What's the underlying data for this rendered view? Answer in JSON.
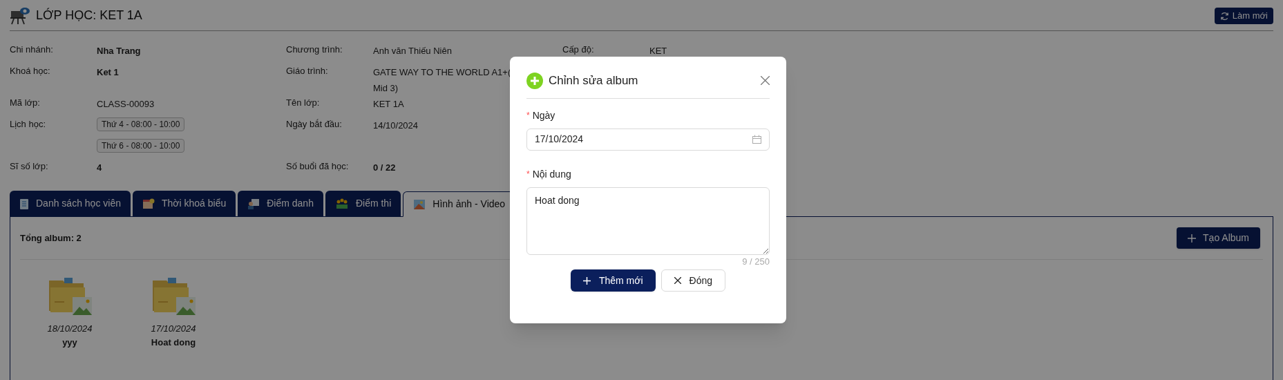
{
  "page": {
    "title": "LỚP HỌC: KET 1A",
    "refresh_button": "Làm mới"
  },
  "info_columns": [
    {
      "rows": [
        {
          "label": "Chi nhánh:",
          "values": [
            "Nha Trang"
          ],
          "bold": true
        },
        {
          "label": "Khoá học:",
          "values": [
            "Ket 1"
          ],
          "bold": true
        },
        {
          "label": "Mã lớp:",
          "values": [
            "CLASS-00093"
          ],
          "bold": false
        },
        {
          "label": "Lịch học:",
          "chips": [
            "Thứ 4 - 08:00 - 10:00",
            "Thứ 6 - 08:00 - 10:00"
          ]
        },
        {
          "label": "Sĩ số lớp:",
          "values": [
            "4"
          ],
          "bold": true
        }
      ]
    },
    {
      "rows": [
        {
          "label": "Chương trình:",
          "values": [
            "Anh văn Thiếu Niên"
          ],
          "bold": false
        },
        {
          "label": "Giáo trình:",
          "values": [
            "GATE WAY TO THE WORLD A1+(",
            "Mid 3)"
          ],
          "bold": false
        },
        {
          "label": "Tên lớp:",
          "values": [
            "KET 1A"
          ],
          "bold": false
        },
        {
          "label": "Ngày bắt đầu:",
          "values": [
            "14/10/2024"
          ],
          "bold": false
        },
        {
          "label": "Số buổi đã học:",
          "values": [
            "0 / 22"
          ],
          "bold": true
        }
      ]
    },
    {
      "rows": [
        {
          "label": "Cấp độ:",
          "values": [
            "KET"
          ],
          "bold": false
        }
      ]
    }
  ],
  "tabs": [
    {
      "label": "Danh sách học viên",
      "kind": "list",
      "selected": false
    },
    {
      "label": "Thời khoá biểu",
      "kind": "calendar",
      "selected": false
    },
    {
      "label": "Điểm danh",
      "kind": "attendance",
      "selected": false
    },
    {
      "label": "Điểm thi",
      "kind": "stars",
      "selected": false
    },
    {
      "label": "Hình ảnh - Video",
      "kind": "image",
      "selected": true
    }
  ],
  "album_panel": {
    "total": "Tổng album: 2",
    "create_button": "Tạo Album",
    "albums": [
      {
        "date": "18/10/2024",
        "name": "yyy"
      },
      {
        "date": "17/10/2024",
        "name": "Hoat dong"
      }
    ]
  },
  "dialog": {
    "title": "Chỉnh sửa album",
    "date_required_mark": "*",
    "date_label": "Ngày",
    "date_value": "17/10/2024",
    "content_required_mark": "*",
    "content_label": "Nội dung",
    "content_value": "Hoat dong",
    "counter": "9 / 250",
    "submit_button": "Thêm mới",
    "close_button": "Đóng"
  }
}
